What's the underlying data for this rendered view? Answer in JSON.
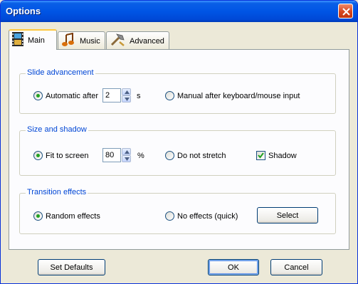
{
  "window": {
    "title": "Options"
  },
  "tabs": [
    {
      "label": "Main",
      "icon": "film-strip-icon",
      "active": true
    },
    {
      "label": "Music",
      "icon": "music-note-icon",
      "active": false
    },
    {
      "label": "Advanced",
      "icon": "hammer-icon",
      "active": false
    }
  ],
  "slide": {
    "title": "Slide advancement",
    "automatic_label": "Automatic after",
    "seconds_value": "2",
    "seconds_unit": "s",
    "manual_label": "Manual after keyboard/mouse input",
    "selected": "automatic"
  },
  "size": {
    "title": "Size and shadow",
    "fit_label": "Fit to screen",
    "percent_value": "80",
    "percent_unit": "%",
    "nostretch_label": "Do not stretch",
    "shadow_label": "Shadow",
    "shadow_checked": true,
    "selected": "fit"
  },
  "transition": {
    "title": "Transition effects",
    "random_label": "Random effects",
    "none_label": "No effects (quick)",
    "select_label": "Select",
    "selected": "random"
  },
  "footer": {
    "defaults_label": "Set Defaults",
    "ok_label": "OK",
    "cancel_label": "Cancel"
  },
  "colors": {
    "titlebar": "#0055e5",
    "group_title": "#0046d5",
    "radio_dot": "#21a121",
    "tab_highlight": "#ffc83c"
  }
}
